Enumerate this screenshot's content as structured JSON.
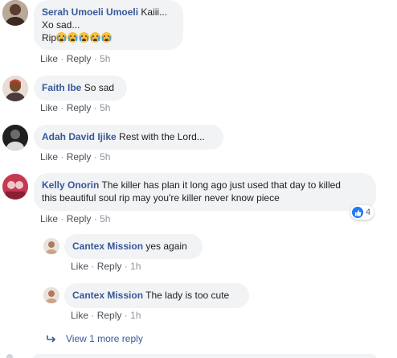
{
  "comments": [
    {
      "author": "Serah Umoeli Umoeli",
      "text_line1": "Kaiii...",
      "text_line2": "Xo sad...",
      "text_line3": "Rip",
      "emoji_name": "loudly-crying-face-icon",
      "like": "Like",
      "reply": "Reply",
      "time": "5h"
    },
    {
      "author": "Faith Ibe",
      "text": "So sad",
      "like": "Like",
      "reply": "Reply",
      "time": "5h"
    },
    {
      "author": "Adah David Ijike",
      "text": "Rest with the Lord...",
      "like": "Like",
      "reply": "Reply",
      "time": "5h"
    },
    {
      "author": "Kelly Onorin",
      "text_line1": "The killer has plan it long ago just used that day to killed",
      "text_line2": "this beautiful soul rip may you're killer never know piece",
      "like": "Like",
      "reply": "Reply",
      "time": "5h",
      "reaction_count": "4",
      "reaction_icon": "like-icon"
    }
  ],
  "replies": [
    {
      "author": "Cantex Mission",
      "text": "yes again",
      "like": "Like",
      "reply": "Reply",
      "time": "1h"
    },
    {
      "author": "Cantex Mission",
      "text": "The lady is too cute",
      "like": "Like",
      "reply": "Reply",
      "time": "1h"
    }
  ],
  "more_replies_label": "View 1 more reply",
  "colors": {
    "author": "#385898",
    "bubble": "#f2f3f5",
    "meta": "#90949c",
    "like_blue": "#2078f4"
  }
}
